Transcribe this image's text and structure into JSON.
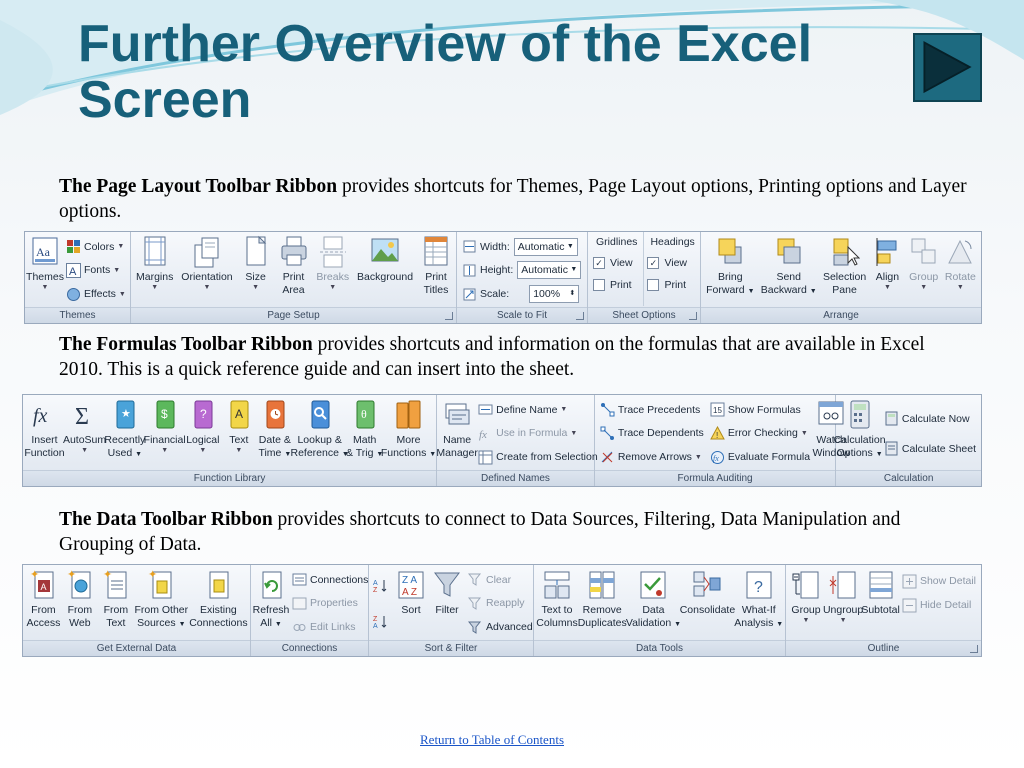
{
  "slide": {
    "title_line1": "Further Overview of the Excel",
    "title_line2": "Screen",
    "footer_link": "Return to Table of Contents"
  },
  "paragraphs": [
    {
      "bold": "The Page  Layout Toolbar  Ribbon",
      "text": " provides shortcuts for Themes, Page Layout options, Printing options and Layer options."
    },
    {
      "bold": "The Formulas Toolbar Ribbon",
      "text": " provides shortcuts and information on the formulas that are available in Excel 2010. This is a quick reference guide and can insert into the sheet."
    },
    {
      "bold": "The Data Toolbar Ribbon",
      "text": " provides shortcuts to connect to Data Sources, Filtering, Data Manipulation and Grouping of Data."
    }
  ],
  "page_layout_ribbon": {
    "groups": {
      "themes": "Themes",
      "page_setup": "Page Setup",
      "scale_to_fit": "Scale to Fit",
      "sheet_options": "Sheet Options",
      "arrange": "Arrange"
    },
    "themes": {
      "themes": "Themes",
      "colors": "Colors",
      "fonts": "Fonts",
      "effects": "Effects"
    },
    "page_setup": {
      "margins": "Margins",
      "orientation": "Orientation",
      "size": "Size",
      "print_area_1": "Print",
      "print_area_2": "Area",
      "breaks": "Breaks",
      "background": "Background",
      "print_titles_1": "Print",
      "print_titles_2": "Titles"
    },
    "scale": {
      "width_label": "Width:",
      "width_value": "Automatic",
      "height_label": "Height:",
      "height_value": "Automatic",
      "scale_label": "Scale:",
      "scale_value": "100%"
    },
    "sheet_options": {
      "gridlines": "Gridlines",
      "headings": "Headings",
      "view": "View",
      "print": "Print"
    },
    "arrange": {
      "bring_1": "Bring",
      "bring_2": "Forward",
      "send_1": "Send",
      "send_2": "Backward",
      "selection_1": "Selection",
      "selection_2": "Pane",
      "align": "Align",
      "group": "Group",
      "rotate": "Rotate"
    }
  },
  "formulas_ribbon": {
    "groups": {
      "function_library": "Function Library",
      "defined_names": "Defined Names",
      "formula_auditing": "Formula Auditing",
      "calculation": "Calculation"
    },
    "function_library": {
      "insert_1": "Insert",
      "insert_2": "Function",
      "autosum": "AutoSum",
      "recent_1": "Recently",
      "recent_2": "Used",
      "financial": "Financial",
      "logical": "Logical",
      "text": "Text",
      "datetime_1": "Date &",
      "datetime_2": "Time",
      "lookup_1": "Lookup &",
      "lookup_2": "Reference",
      "math_1": "Math",
      "math_2": "& Trig",
      "more_1": "More",
      "more_2": "Functions"
    },
    "defined_names": {
      "name_mgr_1": "Name",
      "name_mgr_2": "Manager",
      "define_name": "Define Name",
      "use_in_formula": "Use in Formula",
      "create_from_selection": "Create from Selection"
    },
    "formula_auditing": {
      "trace_precedents": "Trace Precedents",
      "trace_dependents": "Trace Dependents",
      "remove_arrows": "Remove Arrows",
      "show_formulas": "Show Formulas",
      "error_checking": "Error Checking",
      "evaluate_formula": "Evaluate Formula",
      "watch_1": "Watch",
      "watch_2": "Window"
    },
    "calculation": {
      "calc_options_1": "Calculation",
      "calc_options_2": "Options",
      "calc_now": "Calculate Now",
      "calc_sheet": "Calculate Sheet"
    }
  },
  "data_ribbon": {
    "groups": {
      "get_external": "Get External Data",
      "connections": "Connections",
      "sort_filter": "Sort & Filter",
      "data_tools": "Data Tools",
      "outline": "Outline"
    },
    "get_external": {
      "access_1": "From",
      "access_2": "Access",
      "web_1": "From",
      "web_2": "Web",
      "text_1": "From",
      "text_2": "Text",
      "other_1": "From Other",
      "other_2": "Sources",
      "existing_1": "Existing",
      "existing_2": "Connections"
    },
    "connections": {
      "refresh_1": "Refresh",
      "refresh_2": "All",
      "connections": "Connections",
      "properties": "Properties",
      "edit_links": "Edit Links"
    },
    "sort_filter": {
      "sort": "Sort",
      "filter": "Filter",
      "clear": "Clear",
      "reapply": "Reapply",
      "advanced": "Advanced"
    },
    "data_tools": {
      "ttc_1": "Text to",
      "ttc_2": "Columns",
      "rd_1": "Remove",
      "rd_2": "Duplicates",
      "dv_1": "Data",
      "dv_2": "Validation",
      "consolidate": "Consolidate",
      "wif_1": "What-If",
      "wif_2": "Analysis"
    },
    "outline": {
      "group": "Group",
      "ungroup": "Ungroup",
      "subtotal": "Subtotal",
      "show_detail": "Show Detail",
      "hide_detail": "Hide Detail"
    }
  }
}
